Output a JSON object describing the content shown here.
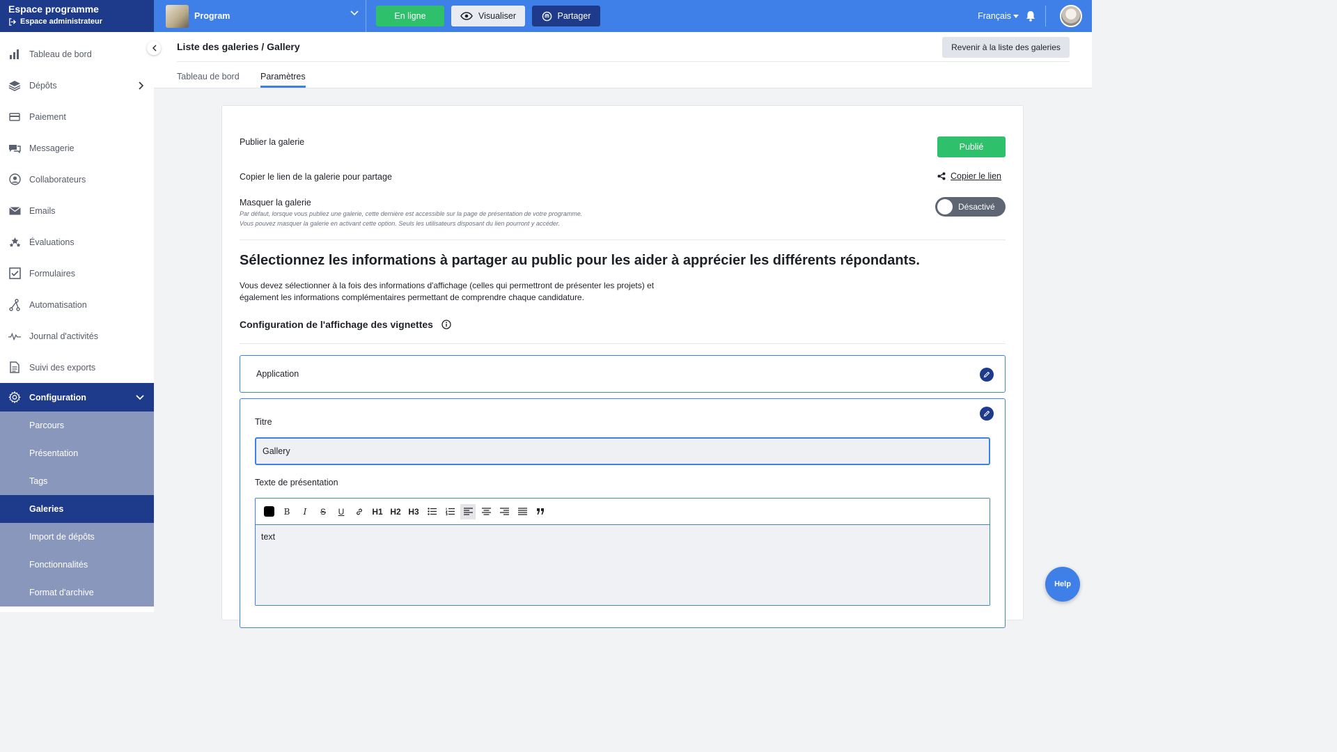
{
  "sidebar": {
    "title": "Espace programme",
    "subtitle": "Espace administrateur",
    "items": [
      {
        "label": "Tableau de bord",
        "icon": "bar-chart-icon"
      },
      {
        "label": "Dépôts",
        "icon": "layers-icon"
      },
      {
        "label": "Paiement",
        "icon": "credit-card-icon"
      },
      {
        "label": "Messagerie",
        "icon": "chat-icon"
      },
      {
        "label": "Collaborateurs",
        "icon": "user-circle-icon"
      },
      {
        "label": "Emails",
        "icon": "envelope-icon"
      },
      {
        "label": "Évaluations",
        "icon": "stars-icon"
      },
      {
        "label": "Formulaires",
        "icon": "checkbox-icon"
      },
      {
        "label": "Automatisation",
        "icon": "flow-icon"
      },
      {
        "label": "Journal d'activités",
        "icon": "activity-icon"
      },
      {
        "label": "Suivi des exports",
        "icon": "document-icon"
      },
      {
        "label": "Configuration",
        "icon": "gear-icon"
      }
    ],
    "sub_items": [
      "Parcours",
      "Présentation",
      "Tags",
      "Galeries",
      "Import de dépôts",
      "Fonctionnalités",
      "Format d'archive"
    ]
  },
  "topbar": {
    "program": "Program",
    "online": "En ligne",
    "view": "Visualiser",
    "share": "Partager",
    "language": "Français"
  },
  "header": {
    "title": "Liste des galeries / Gallery",
    "back_button": "Revenir à la liste des galeries",
    "tabs": [
      "Tableau de bord",
      "Paramètres"
    ]
  },
  "card": {
    "publish_label": "Publier la galerie",
    "publish_status": "Publié",
    "copy_label": "Copier le lien de la galerie pour partage",
    "copy_link": "Copier le lien",
    "hide_label": "Masquer la galerie",
    "hide_hint_1": "Par défaut, lorsque vous publiez une galerie, cette dernière est accessible sur la page de présentation de votre programme.",
    "hide_hint_2": "Vous pouvez masquer la galerie en activant cette option. Seuls les utilisateurs disposant du lien pourront y accéder.",
    "hide_toggle": "Désactivé",
    "section_title": "Sélectionnez les informations à partager au public pour les aider à apprécier les différents répondants.",
    "section_desc_1": "Vous devez sélectionner à la fois des informations d'affichage (celles qui permettront de présenter les projets) et",
    "section_desc_2": "également les informations complémentaires permettant de comprendre chaque candidature.",
    "config_title": "Configuration de l'affichage des vignettes",
    "panel_application": "Application",
    "title_label": "Titre",
    "title_value": "Gallery",
    "text_label": "Texte de présentation",
    "editor_text": "text",
    "toolbar": [
      "B",
      "I",
      "S",
      "U",
      "H1",
      "H2",
      "H3"
    ]
  },
  "help": "Help"
}
